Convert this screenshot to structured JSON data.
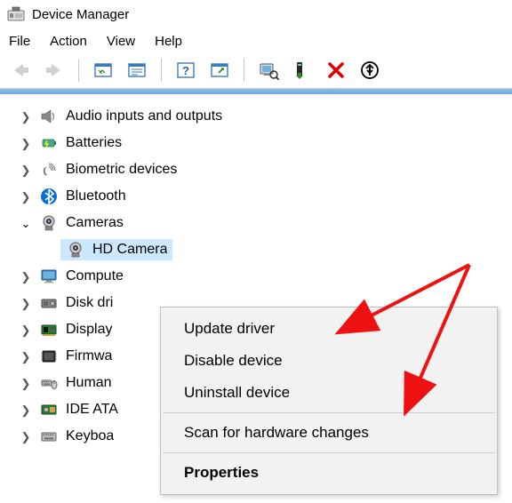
{
  "title": "Device Manager",
  "menu": {
    "file": "File",
    "action": "Action",
    "view": "View",
    "help": "Help"
  },
  "tree": {
    "items": [
      {
        "label": "Audio inputs and outputs"
      },
      {
        "label": "Batteries"
      },
      {
        "label": "Biometric devices"
      },
      {
        "label": "Bluetooth"
      },
      {
        "label": "Cameras"
      },
      {
        "label": "Compute"
      },
      {
        "label": "Disk dri"
      },
      {
        "label": "Display"
      },
      {
        "label": "Firmwa"
      },
      {
        "label": "Human"
      },
      {
        "label": "IDE ATA"
      },
      {
        "label": "Keyboa"
      }
    ],
    "camera_child": "HD Camera"
  },
  "context_menu": {
    "update": "Update driver",
    "disable": "Disable device",
    "uninstall": "Uninstall device",
    "scan": "Scan for hardware changes",
    "properties": "Properties"
  }
}
